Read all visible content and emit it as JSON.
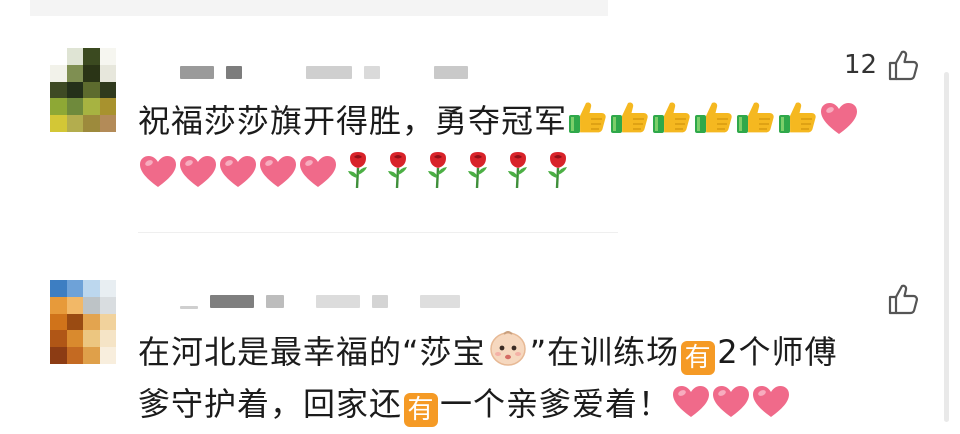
{
  "comments": [
    {
      "like_count": "12",
      "line1": "祝福莎莎旗开得胜，勇夺冠军",
      "line1_emojis": [
        "thumbs-up",
        "thumbs-up",
        "thumbs-up",
        "thumbs-up",
        "thumbs-up",
        "thumbs-up",
        "heart"
      ],
      "line2_emojis": [
        "heart",
        "heart",
        "heart",
        "heart",
        "heart",
        "rose",
        "rose",
        "rose",
        "rose",
        "rose",
        "rose"
      ]
    },
    {
      "line1_a": "在河北是最幸福的“莎宝",
      "line1_b": "”在训练场",
      "line1_c": "2个师傅",
      "line2_a": "爹守护着，回家还",
      "line2_b": "一个亲爹爱着！",
      "badge_text": "有",
      "line2_emojis": [
        "heart",
        "heart",
        "heart"
      ]
    }
  ],
  "colors": {
    "heart": "#f06a8a",
    "rose": "#d8232a",
    "thumb": "#f5b820",
    "cuff": "#2fa84a",
    "badge": "#f59a25"
  }
}
